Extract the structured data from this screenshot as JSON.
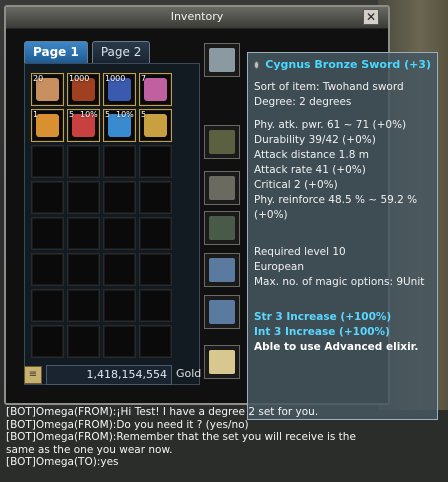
{
  "window": {
    "title": "Inventory",
    "close_label": "✕"
  },
  "tabs": [
    {
      "label": "Page 1",
      "active": true
    },
    {
      "label": "Page 2",
      "active": false
    }
  ],
  "bag": {
    "slots": [
      {
        "qty": "20",
        "pct": "",
        "color": "#c89060",
        "icon": "scroll-icon"
      },
      {
        "qty": "1000",
        "pct": "",
        "color": "#a04020",
        "icon": "hp-potion-icon"
      },
      {
        "qty": "1000",
        "pct": "",
        "color": "#3a5ab0",
        "icon": "mp-potion-icon"
      },
      {
        "qty": "7",
        "pct": "",
        "color": "#c060a0",
        "icon": "pill-icon"
      },
      {
        "qty": "1",
        "pct": "",
        "color": "#d89030",
        "icon": "pet-icon"
      },
      {
        "qty": "5",
        "pct": "10%",
        "color": "#c84040",
        "icon": "elixir-icon"
      },
      {
        "qty": "5",
        "pct": "10%",
        "color": "#3a8ad0",
        "icon": "elixir-icon"
      },
      {
        "qty": "5",
        "pct": "",
        "color": "#c8a040",
        "icon": "stone-icon"
      }
    ],
    "total_slots": 32
  },
  "gold": {
    "value": "1,418,154,554",
    "label": "Gold"
  },
  "equipment": [
    {
      "icon": "sword-icon",
      "color": "#8a9aa0"
    },
    {
      "icon": "shoulder-armor-icon",
      "color": "#5a6040"
    },
    {
      "icon": "chest-armor-icon",
      "color": "#6a6a60"
    },
    {
      "icon": "leg-armor-icon",
      "color": "#4a5a48"
    },
    {
      "icon": "earring-icon",
      "color": "#5a7aa0"
    },
    {
      "icon": "ring-icon",
      "color": "#5a7aa0"
    },
    {
      "icon": "avatar-icon",
      "color": "#d8c890"
    }
  ],
  "tooltip": {
    "name": "Cygnus Bronze Sword (+3)",
    "lines_a": [
      "Sort of item: Twohand sword",
      "Degree: 2 degrees"
    ],
    "lines_b": [
      "Phy. atk. pwr. 61 ~ 71 (+0%)",
      "Durability 39/42 (+0%)",
      "Attack distance 1.8 m",
      "Attack rate 41 (+0%)",
      "Critical 2 (+0%)",
      "Phy.  reinforce 48.5 % ~ 59.2 %",
      "(+0%)"
    ],
    "lines_c": [
      "Required level 10",
      "European",
      "Max. no. of magic options: 9Unit"
    ],
    "blue_lines": [
      "Str 3 Increase (+100%)",
      "Int 3 Increase (+100%)"
    ],
    "footer": "Able to use Advanced elixir."
  },
  "chat": [
    "[BOT]Omega(FROM):¡Hi Test! I have a degree 2 set for you.",
    "[BOT]Omega(FROM):Do you need it ? (yes/no)",
    "[BOT]Omega(FROM):Remember that the set you will receive is the",
    "     same as the one you wear now.",
    "[BOT]Omega(TO):yes"
  ]
}
